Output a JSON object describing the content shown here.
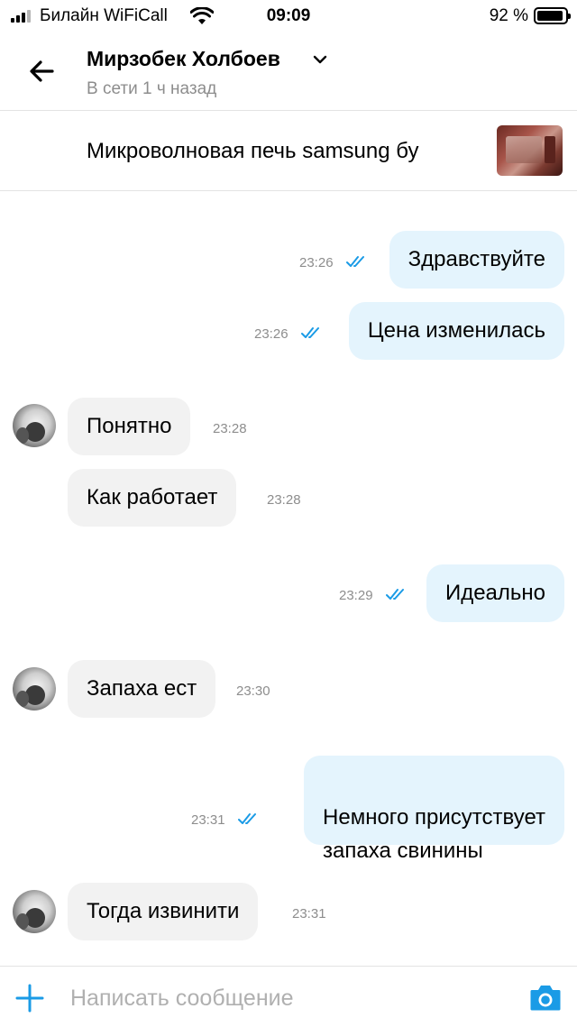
{
  "status_bar": {
    "carrier": "Билайн WiFiCall",
    "time": "09:09",
    "battery": "92 %"
  },
  "header": {
    "name": "Мирзобек Холбоев",
    "last_seen": "В сети 1 ч назад"
  },
  "product": {
    "title": "Микроволновая печь samsung бу"
  },
  "messages": [
    {
      "direction": "out",
      "text": "Здравствуйте",
      "time": "23:26"
    },
    {
      "direction": "out",
      "text": "Цена изменилась",
      "time": "23:26"
    },
    {
      "direction": "in",
      "text": "Понятно",
      "time": "23:28"
    },
    {
      "direction": "in",
      "text": "Как работает",
      "time": "23:28"
    },
    {
      "direction": "out",
      "text": "Идеально",
      "time": "23:29"
    },
    {
      "direction": "in",
      "text": "Запаха ест",
      "time": "23:30"
    },
    {
      "direction": "out",
      "text": "Немного присутствует\nзапаха свинины",
      "time": "23:31"
    },
    {
      "direction": "in",
      "text": "Тогда извинити",
      "time": "23:31"
    }
  ],
  "composer": {
    "placeholder": "Написать сообщение"
  },
  "colors": {
    "accent": "#1a9be6",
    "outgoing_bubble": "#e4f4fd",
    "incoming_bubble": "#f2f2f2",
    "muted_text": "#8d8d8d"
  },
  "icons": {
    "back": "arrow-left-icon",
    "dropdown": "chevron-down-icon",
    "read_status": "double-check-icon",
    "add": "plus-icon",
    "camera": "camera-icon"
  }
}
